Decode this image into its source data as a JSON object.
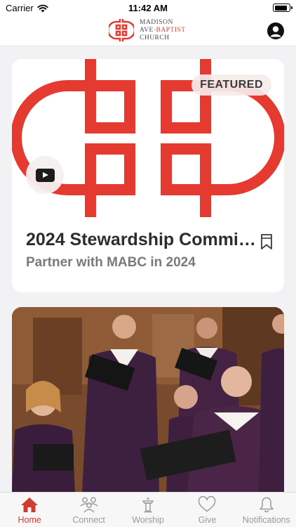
{
  "status_bar": {
    "carrier": "Carrier",
    "time": "11:42 AM",
    "battery_level": 0.9
  },
  "header": {
    "logo_lines": [
      "MADISON",
      "AVE",
      "BAPTIST",
      "CHURCH"
    ],
    "brand_color": "#e53a30",
    "profile_icon": "person-circle-icon"
  },
  "featured_card": {
    "badge": "FEATURED",
    "title": "2024 Stewardship Commit...",
    "subtitle": "Partner with MABC in 2024",
    "media_icon": "play-video-icon",
    "bookmark_icon": "bookmark-icon"
  },
  "second_card": {
    "image": "choir-singers-photo"
  },
  "tab_bar": {
    "active_color": "#d23c2e",
    "inactive_color": "#9a9a9e",
    "tabs": [
      {
        "label": "Home",
        "icon": "home-icon",
        "active": true
      },
      {
        "label": "Connect",
        "icon": "people-icon",
        "active": false
      },
      {
        "label": "Worship",
        "icon": "pulpit-icon",
        "active": false
      },
      {
        "label": "Give",
        "icon": "heart-icon",
        "active": false
      },
      {
        "label": "Notifications",
        "icon": "bell-icon",
        "active": false
      }
    ]
  }
}
